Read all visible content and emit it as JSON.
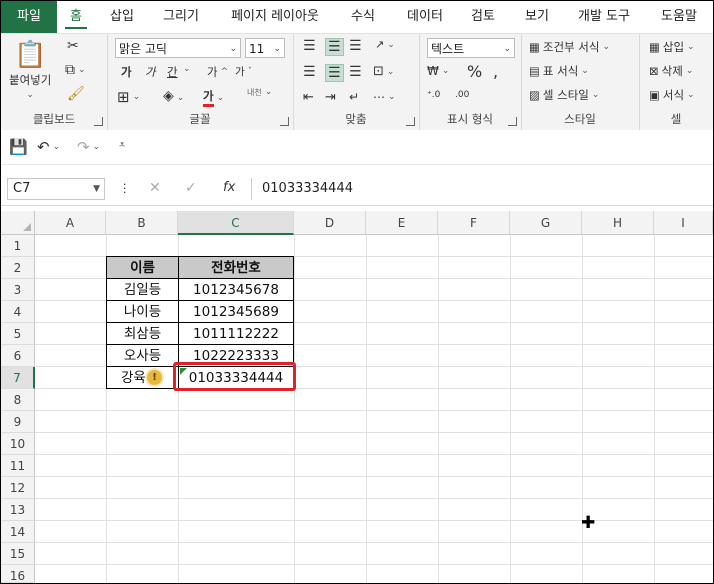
{
  "tabs": [
    "파일",
    "홈",
    "삽입",
    "그리기",
    "페이지 레이아웃",
    "수식",
    "데이터",
    "검토",
    "보기",
    "개발 도구",
    "도움말"
  ],
  "active_tab": "홈",
  "ribbon": {
    "clipboard": {
      "label": "클립보드",
      "paste": "붙여넣기"
    },
    "font": {
      "label": "글꼴",
      "font_name": "맑은 고딕",
      "font_size": "11",
      "bold": "가",
      "italic": "가",
      "underline": "간",
      "grow": "가",
      "shrink": "가",
      "font_color": "가",
      "phonetic": "내천"
    },
    "alignment": {
      "label": "맞춤"
    },
    "number": {
      "label": "표시 형식",
      "format": "텍스트"
    },
    "styles": {
      "label": "스타일",
      "conditional": "조건부 서식",
      "table": "표 서식",
      "cell": "셀 스타일"
    },
    "cells": {
      "label": "셀",
      "insert": "삽입",
      "delete": "삭제",
      "format": "서식"
    }
  },
  "formula_bar": {
    "name_box": "C7",
    "cancel": "✕",
    "confirm": "✓",
    "fx": "fx",
    "value": "01033334444"
  },
  "columns": [
    "A",
    "B",
    "C",
    "D",
    "E",
    "F",
    "G",
    "H",
    "I"
  ],
  "rows": [
    "1",
    "2",
    "3",
    "4",
    "5",
    "6",
    "7",
    "8",
    "9",
    "10",
    "11",
    "12",
    "13",
    "14",
    "15",
    "16"
  ],
  "selected_cell": "C7",
  "table": {
    "headers": [
      "이름",
      "전화번호"
    ],
    "rows": [
      [
        "김일등",
        "1012345678"
      ],
      [
        "나이등",
        "1012345689"
      ],
      [
        "최삼등",
        "1011112222"
      ],
      [
        "오사등",
        "1022223333"
      ],
      [
        "강육",
        "01033334444"
      ]
    ]
  },
  "colors": {
    "accent": "#217346",
    "highlight_box": "#e0232a",
    "header_fill": "#c9c9c9",
    "warning": "#e8b838"
  }
}
